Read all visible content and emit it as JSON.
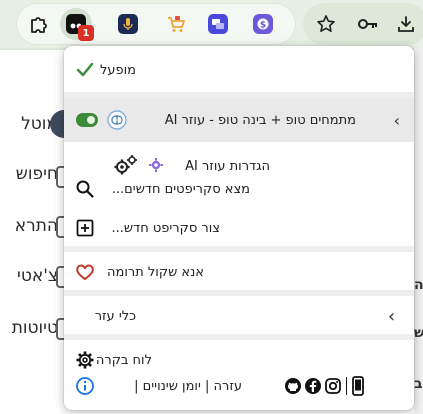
{
  "toolbar": {
    "badge_count": "1",
    "icons": [
      "puzzle-extensions-icon",
      "tampermonkey-icon",
      "microphone-extension-icon",
      "cart-extension-icon",
      "chat-translate-icon",
      "dollar-extension-icon",
      "bookmark-star-icon",
      "password-key-icon",
      "download-icon"
    ]
  },
  "page": {
    "left_items": [
      "מוטל",
      "חיפוש",
      "התרא",
      "צ'אטי",
      "טיוטות"
    ],
    "right_fragments": [
      "ה",
      "ש",
      "ב"
    ]
  },
  "menu": {
    "enabled_label": "מופעל",
    "script_name": "מתמחים טופ + בינה טופ - עוזר AI",
    "script_toggle_state": "on",
    "ai_settings_label": "הגדרות עוזר AI",
    "find_scripts_label": "מצא סקריפטים חדשים...",
    "create_script_label": "צור סקריפט חדש...",
    "donate_label": "אנא שקול תרומה",
    "utilities_label": "כלי עזר",
    "dashboard_label": "לוח בקרה",
    "footer_label": "עזרה | יומן שינויים |",
    "accent_color": "#3c8a3c",
    "heart_color": "#c0392b"
  }
}
